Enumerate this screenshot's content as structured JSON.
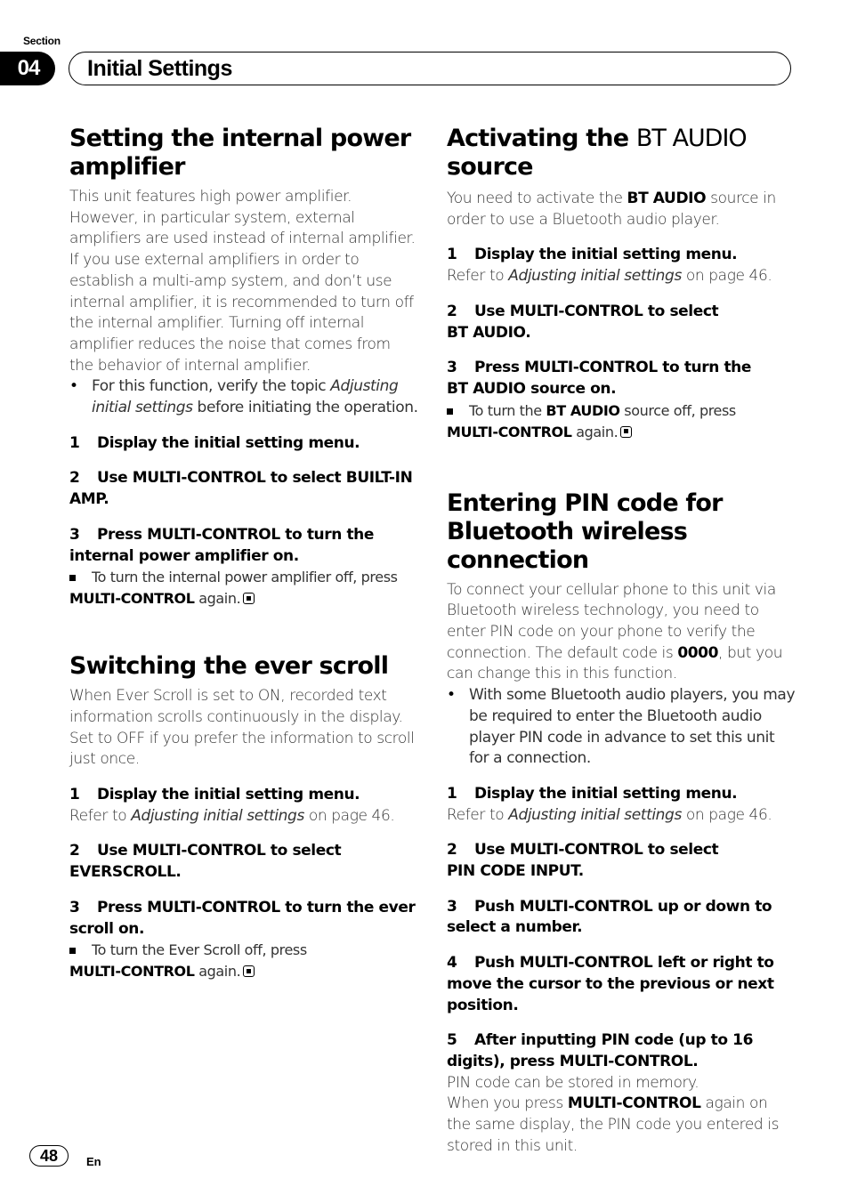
{
  "header": {
    "section_label": "Section",
    "section_number": "04",
    "section_title": "Initial Settings"
  },
  "left_column": {
    "amp": {
      "title": "Setting the internal power amplifier",
      "intro": "This unit features high power amplifier. However, in particular system, external amplifiers are used instead of internal amplifier. If you use external amplifiers in order to establish a multi-amp system, and don’t use internal amplifier, it is recommended to turn off the internal amplifier. Turning off internal amplifier reduces the noise that comes from the behavior of internal amplifier.",
      "bullet_pre": "For this function, verify the topic ",
      "bullet_link": "Adjusting initial settings",
      "bullet_post": " before initiating the operation.",
      "step1_num": "1",
      "step1": "Display the initial setting menu.",
      "step2_num": "2",
      "step2": "Use MULTI-CONTROL to select BUILT-IN AMP.",
      "step3_num": "3",
      "step3": "Press MULTI-CONTROL to turn the internal power amplifier on.",
      "note_pre": "To turn the internal power amplifier off, press ",
      "note_key": "MULTI-CONTROL",
      "note_post": " again."
    },
    "scroll": {
      "title": "Switching the ever scroll",
      "intro": "When Ever Scroll is set to ON, recorded text information scrolls continuously in the display. Set to OFF if you prefer the information to scroll just once.",
      "step1_num": "1",
      "step1": "Display the initial setting menu.",
      "step1_ref_pre": "Refer to ",
      "step1_ref_link": "Adjusting initial settings",
      "step1_ref_post": " on page 46.",
      "step2_num": "2",
      "step2": "Use MULTI-CONTROL to select EVERSCROLL.",
      "step3_num": "3",
      "step3": "Press MULTI-CONTROL to turn the ever scroll on.",
      "note_pre": "To turn the Ever Scroll off, press ",
      "note_key": "MULTI-CONTROL",
      "note_post": " again."
    }
  },
  "right_column": {
    "bt": {
      "title_bold1": "Activating the ",
      "title_light": "BT AUDIO",
      "title_bold2": " source",
      "intro_pre": "You need to activate the ",
      "intro_key": "BT AUDIO",
      "intro_post": " source in order to use a Bluetooth audio player.",
      "step1_num": "1",
      "step1": "Display the initial setting menu.",
      "step1_ref_pre": "Refer to ",
      "step1_ref_link": "Adjusting initial settings",
      "step1_ref_post": " on page 46.",
      "step2_num": "2",
      "step2": "Use MULTI-CONTROL to select BT AUDIO.",
      "step3_num": "3",
      "step3": "Press MULTI-CONTROL to turn the BT AUDIO source on.",
      "note_pre": "To turn the ",
      "note_key1": "BT AUDIO",
      "note_mid": " source off, press ",
      "note_key2": "MULTI-CONTROL",
      "note_post": " again."
    },
    "pin": {
      "title": "Entering PIN code for Bluetooth wireless connection",
      "intro_pre": "To connect your cellular phone to this unit via Bluetooth wireless technology, you need to enter PIN code on your phone to verify the connection. The default code is ",
      "intro_key": "0000",
      "intro_post": ", but you can change this in this function.",
      "bullet": "With some Bluetooth audio players, you may be required to enter the Bluetooth audio player PIN code in advance to set this unit for a connection.",
      "step1_num": "1",
      "step1": "Display the initial setting menu.",
      "step1_ref_pre": "Refer to ",
      "step1_ref_link": "Adjusting initial settings",
      "step1_ref_post": " on page 46.",
      "step2_num": "2",
      "step2": "Use MULTI-CONTROL to select PIN CODE INPUT.",
      "step3_num": "3",
      "step3": "Push MULTI-CONTROL up or down to select a number.",
      "step4_num": "4",
      "step4": "Push MULTI-CONTROL left or right to move the cursor to the previous or next position.",
      "step5_num": "5",
      "step5": "After inputting PIN code (up to 16 digits), press MULTI-CONTROL.",
      "step5_text1": "PIN code can be stored in memory.",
      "step5_text2_pre": "When you press ",
      "step5_text2_key": "MULTI-CONTROL",
      "step5_text2_post": " again on the same display, the PIN code you entered is stored in this unit."
    }
  },
  "footer": {
    "page_number": "48",
    "language": "En"
  }
}
